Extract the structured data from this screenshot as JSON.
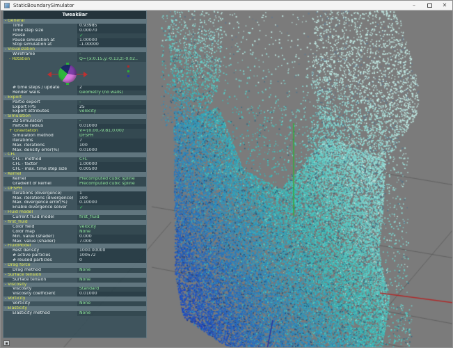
{
  "window": {
    "title": "StaticBoundarySimulator",
    "controls": {
      "minimize": "–",
      "maximize": "□",
      "close": "✕"
    }
  },
  "panel": {
    "title": "TweakBar",
    "rows": [
      {
        "t": "group",
        "label": "General"
      },
      {
        "t": "item",
        "label": "Time",
        "value": "0.93985",
        "vk": "num"
      },
      {
        "t": "item",
        "label": "Time step size",
        "value": "0.00070",
        "vk": "num"
      },
      {
        "t": "item",
        "label": "Pause",
        "value": "✓",
        "vk": "check"
      },
      {
        "t": "item",
        "label": "Pause simulation at",
        "value": "1.00000",
        "vk": "num"
      },
      {
        "t": "item",
        "label": "Stop simulation at",
        "value": "-1.00000",
        "vk": "num"
      },
      {
        "t": "group",
        "label": "Visualization"
      },
      {
        "t": "item",
        "label": "Wireframe",
        "value": "-",
        "vk": "enum"
      },
      {
        "t": "sub",
        "fold": "-",
        "label": "Rotation",
        "value": "Q={x:0.15,y:-0.13,z:-0.02..",
        "vk": "enum"
      },
      {
        "t": "ball"
      },
      {
        "t": "item",
        "label": "# time steps / update",
        "value": "2",
        "vk": "num"
      },
      {
        "t": "item",
        "label": "Render walls",
        "value": "Geometry (no walls)",
        "vk": "enum"
      },
      {
        "t": "group",
        "label": "Export"
      },
      {
        "t": "item",
        "label": "Partio export",
        "value": "-",
        "vk": "enum"
      },
      {
        "t": "item",
        "label": "Export FPS",
        "value": "25",
        "vk": "num"
      },
      {
        "t": "item",
        "label": "Export attributes",
        "value": "velocity",
        "vk": "enum"
      },
      {
        "t": "group",
        "label": "Simulation"
      },
      {
        "t": "item",
        "label": "2D Simulation",
        "value": "-",
        "vk": "enum"
      },
      {
        "t": "item",
        "label": "Particle radius",
        "value": "0.01000",
        "vk": "num"
      },
      {
        "t": "sub",
        "fold": "+",
        "label": "Gravitation",
        "value": "V={0.00,-9.81,0.00}",
        "vk": "enum"
      },
      {
        "t": "item",
        "label": "Simulation method",
        "value": "DFSPH",
        "vk": "enum"
      },
      {
        "t": "item",
        "label": "Iterations",
        "value": "7",
        "vk": "num"
      },
      {
        "t": "item",
        "label": "Max. iterations",
        "value": "100",
        "vk": "num"
      },
      {
        "t": "item",
        "label": "Max. density error(%)",
        "value": "0.01000",
        "vk": "num"
      },
      {
        "t": "group",
        "label": "CFL"
      },
      {
        "t": "item",
        "label": "CFL - method",
        "value": "CFL",
        "vk": "enum"
      },
      {
        "t": "item",
        "label": "CFL - factor",
        "value": "1.00000",
        "vk": "num"
      },
      {
        "t": "item",
        "label": "CFL - max. time step size",
        "value": "0.00500",
        "vk": "num"
      },
      {
        "t": "group",
        "label": "Kernel"
      },
      {
        "t": "item",
        "label": "Kernel",
        "value": "Precomputed cubic spline",
        "vk": "enum"
      },
      {
        "t": "item",
        "label": "Gradient of kernel",
        "value": "Precomputed cubic spline",
        "vk": "enum"
      },
      {
        "t": "group",
        "label": "DFSPH"
      },
      {
        "t": "item",
        "label": "Iterations (divergence)",
        "value": "1",
        "vk": "num"
      },
      {
        "t": "item",
        "label": "Max. iterations (divergence)",
        "value": "100",
        "vk": "num"
      },
      {
        "t": "item",
        "label": "Max. divergence error(%)",
        "value": "0.10000",
        "vk": "num"
      },
      {
        "t": "item",
        "label": "Enable divergence solver",
        "value": "✓",
        "vk": "check"
      },
      {
        "t": "group",
        "label": "Fluid model"
      },
      {
        "t": "item",
        "label": "Current fluid model",
        "value": "first_fluid",
        "vk": "enum"
      },
      {
        "t": "group",
        "label": "first_fluid"
      },
      {
        "t": "item",
        "label": "Color field",
        "value": "velocity",
        "vk": "enum"
      },
      {
        "t": "item",
        "label": "Color map",
        "value": "None",
        "vk": "enum"
      },
      {
        "t": "item",
        "label": "Min. value (shader)",
        "value": "0.000",
        "vk": "num"
      },
      {
        "t": "item",
        "label": "Max. value (shader)",
        "value": "7.000",
        "vk": "num"
      },
      {
        "t": "group",
        "label": "FluidModel"
      },
      {
        "t": "item",
        "label": "Rest density",
        "value": "1000.00000",
        "vk": "num"
      },
      {
        "t": "item",
        "label": "# active particles",
        "value": "100572",
        "vk": "num"
      },
      {
        "t": "item",
        "label": "# reused particles",
        "value": "0",
        "vk": "num"
      },
      {
        "t": "group",
        "label": "Drag force"
      },
      {
        "t": "item",
        "label": "Drag method",
        "value": "None",
        "vk": "enum"
      },
      {
        "t": "group",
        "label": "Surface tension"
      },
      {
        "t": "item",
        "label": "Surface tension",
        "value": "None",
        "vk": "enum"
      },
      {
        "t": "group",
        "label": "Viscosity"
      },
      {
        "t": "item",
        "label": "Viscosity",
        "value": "Standard",
        "vk": "enum"
      },
      {
        "t": "item",
        "label": "Viscosity coefficient",
        "value": "0.01000",
        "vk": "num"
      },
      {
        "t": "group",
        "label": "Vorticity"
      },
      {
        "t": "item",
        "label": "Vorticity",
        "value": "None",
        "vk": "enum"
      },
      {
        "t": "group",
        "label": "Elasticity"
      },
      {
        "t": "item",
        "label": "Elasticity method",
        "value": "None",
        "vk": "enum"
      }
    ]
  },
  "viewport": {
    "background": "#7b7b7b",
    "grid_color": "#606060",
    "axes": {
      "x_color": "#b02a2a",
      "y_color": "#2fae3a",
      "z_color": "#2b35a0"
    },
    "particles": {
      "deep_blue": "#1d3bc0",
      "teal": "#3cc0ba",
      "pale_cyan": "#c3ebe5",
      "speckle_dark": "#233056"
    }
  }
}
